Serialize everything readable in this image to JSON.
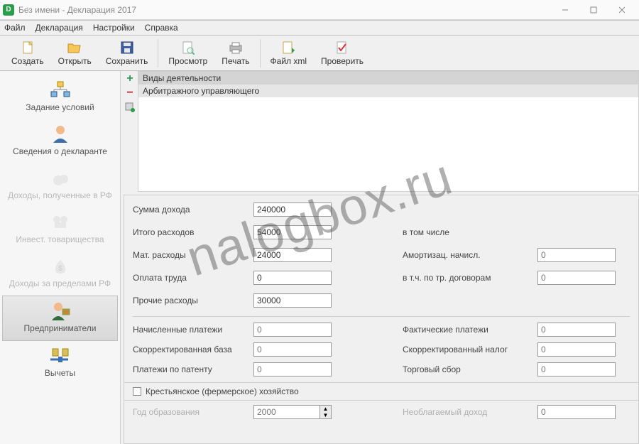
{
  "window": {
    "title": "Без имени - Декларация 2017",
    "app_glyph": "D"
  },
  "menu": {
    "file": "Файл",
    "declaration": "Декларация",
    "settings": "Настройки",
    "help": "Справка"
  },
  "toolbar": {
    "create": "Создать",
    "open": "Открыть",
    "save": "Сохранить",
    "preview": "Просмотр",
    "print": "Печать",
    "file_xml": "Файл xml",
    "check": "Проверить"
  },
  "sidebar": {
    "items": [
      {
        "label": "Задание условий"
      },
      {
        "label": "Сведения о декларанте"
      },
      {
        "label": "Доходы, полученные в РФ"
      },
      {
        "label": "Инвест. товарищества"
      },
      {
        "label": "Доходы за пределами РФ"
      },
      {
        "label": "Предприниматели"
      },
      {
        "label": "Вычеты"
      }
    ]
  },
  "activity": {
    "header": "Виды деятельности",
    "row1": "Арбитражного управляющего"
  },
  "form": {
    "sum_income_lbl": "Сумма дохода",
    "sum_income": "240000",
    "total_expenses_lbl": "Итого расходов",
    "total_expenses": "54000",
    "including_lbl": "в том числе",
    "mat_expenses_lbl": "Мат. расходы",
    "mat_expenses": "24000",
    "amort_lbl": "Амортизац. начисл.",
    "amort": "0",
    "labor_lbl": "Оплата труда",
    "labor": "0",
    "contracts_lbl": "в т.ч. по тр. договорам",
    "contracts": "0",
    "other_expenses_lbl": "Прочие расходы",
    "other_expenses": "30000",
    "accrued_lbl": "Начисленные платежи",
    "accrued": "0",
    "actual_lbl": "Фактические платежи",
    "actual": "0",
    "adjusted_base_lbl": "Скорректированная база",
    "adjusted_base": "0",
    "adjusted_tax_lbl": "Скорректированный налог",
    "adjusted_tax": "0",
    "patent_lbl": "Платежи по патенту",
    "patent": "0",
    "trade_fee_lbl": "Торговый сбор",
    "trade_fee": "0",
    "farm_check_lbl": "Крестьянское (фермерское) хозяйство",
    "year_lbl": "Год образования",
    "year": "2000",
    "nontax_lbl": "Необлагаемый доход",
    "nontax": "0"
  },
  "watermark": "nalogbox.ru"
}
